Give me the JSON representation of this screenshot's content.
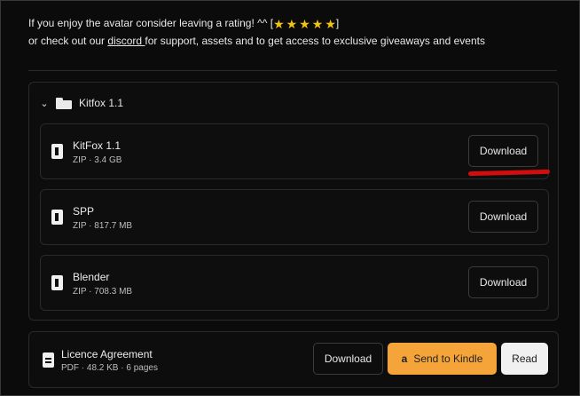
{
  "intro": {
    "line1_text": "If you enjoy the avatar consider leaving a rating! ^^ [",
    "line1_close": "]",
    "line2_prefix": "or check out our ",
    "discord_link": "discord ",
    "line2_suffix": "for support, assets and to get access to exclusive giveaways and events",
    "rating_stars": 5
  },
  "group": {
    "title": "Kitfox 1.1",
    "files": [
      {
        "name": "KitFox 1.1",
        "meta": "ZIP · 3.4 GB",
        "action": "Download"
      },
      {
        "name": "SPP",
        "meta": "ZIP · 817.7 MB",
        "action": "Download"
      },
      {
        "name": "Blender",
        "meta": "ZIP · 708.3 MB",
        "action": "Download"
      }
    ]
  },
  "licence": {
    "name": "Licence Agreement",
    "meta": "PDF · 48.2 KB · 6 pages",
    "download_label": "Download",
    "kindle_label": "Send to Kindle",
    "read_label": "Read"
  },
  "colors": {
    "accent_kindle": "#f5a43a",
    "star": "#f2c313",
    "annotation_red": "#d10d0d"
  }
}
